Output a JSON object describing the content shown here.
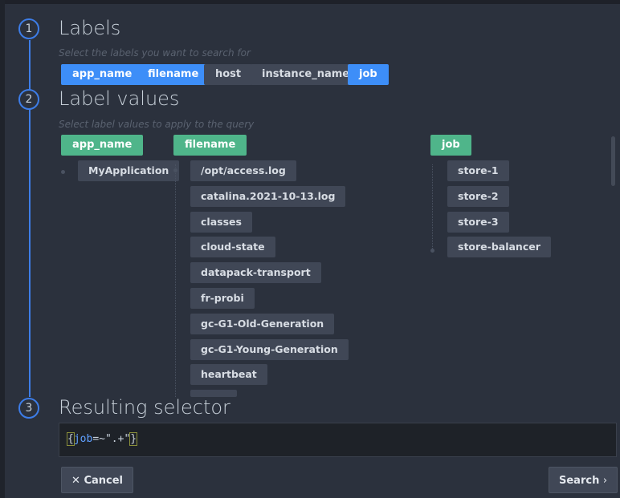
{
  "steps": [
    {
      "number": "1",
      "title": "Labels",
      "hint": "Select the labels you want to search for"
    },
    {
      "number": "2",
      "title": "Label values",
      "hint": "Select label values to apply to the query"
    },
    {
      "number": "3",
      "title": "Resulting selector"
    }
  ],
  "labels": [
    {
      "name": "app_name",
      "selected": true
    },
    {
      "name": "filename",
      "selected": true
    },
    {
      "name": "host",
      "selected": false
    },
    {
      "name": "instance_name",
      "selected": false
    },
    {
      "name": "job",
      "selected": true
    }
  ],
  "value_columns": {
    "app_name": {
      "header": "app_name",
      "values": [
        "MyApplication"
      ]
    },
    "filename": {
      "header": "filename",
      "values": [
        "/opt/access.log",
        "catalina.2021-10-13.log",
        "classes",
        "cloud-state",
        "datapack-transport",
        "fr-probi",
        "gc-G1-Old-Generation",
        "gc-G1-Young-Generation",
        "heartbeat"
      ]
    },
    "job": {
      "header": "job",
      "values": [
        "store-1",
        "store-2",
        "store-3",
        "store-balancer"
      ]
    }
  },
  "selector": {
    "open": "{",
    "key": "job",
    "op": "=~",
    "value": "\".+\"",
    "close": "}"
  },
  "buttons": {
    "cancel": "Cancel",
    "search": "Search"
  },
  "colors": {
    "accent": "#3d8ef8",
    "green": "#4fb58a",
    "rail": "#3d7de8"
  },
  "icons": {
    "cancel": "close-icon",
    "search": "chevron-right-icon"
  }
}
